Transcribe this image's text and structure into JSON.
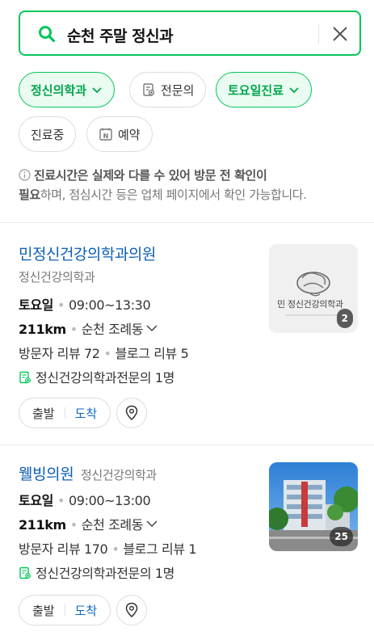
{
  "search": {
    "query": "순천 주말 정신과"
  },
  "filters": {
    "chips": [
      {
        "label": "정신의학과",
        "active": true,
        "dropdown": true
      },
      {
        "label": "전문의",
        "active": false,
        "icon": "certificate-icon"
      },
      {
        "label": "토요일진료",
        "active": true,
        "dropdown": true
      },
      {
        "label": "진료중",
        "active": false
      },
      {
        "label": "예약",
        "active": false,
        "icon": "naver-booking-icon"
      }
    ]
  },
  "notice": {
    "bold": "진료시간은 실제와 다를 수 있어 방문 전 확인이",
    "bold2": "필요",
    "rest": "하며, 점심시간 등은 업체 페이지에서 확인 가능합니다."
  },
  "results": [
    {
      "name": "민정신건강의학과의원",
      "category": "정신건강의학과",
      "day": "토요일",
      "hours": "09:00~13:30",
      "distance": "211km",
      "location": "순천 조례동",
      "visitor_reviews": "방문자 리뷰 72",
      "blog_reviews": "블로그 리뷰 5",
      "specialist": "정신건강의학과전문의 1명",
      "photo_count": "2",
      "logo_text": "민 정신건강의학과",
      "depart": "출발",
      "arrive": "도착"
    },
    {
      "name": "웰빙의원",
      "category": "정신건강의학과",
      "day": "토요일",
      "hours": "09:00~13:00",
      "distance": "211km",
      "location": "순천 조례동",
      "visitor_reviews": "방문자 리뷰 170",
      "blog_reviews": "블로그 리뷰 1",
      "specialist": "정신건강의학과전문의 1명",
      "photo_count": "25",
      "depart": "출발",
      "arrive": "도착"
    }
  ],
  "colors": {
    "brand": "#03c75a",
    "link": "#0d5fb6"
  }
}
